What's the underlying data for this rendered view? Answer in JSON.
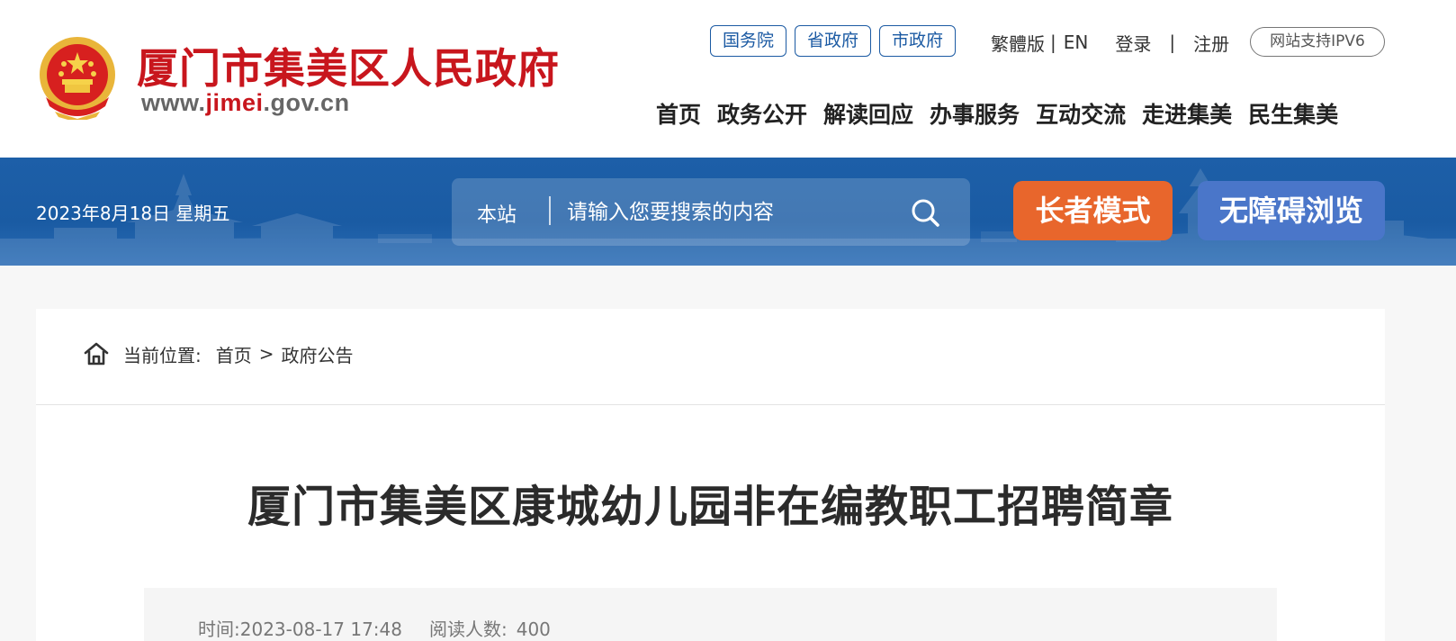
{
  "header": {
    "site_title": "厦门市集美区人民政府",
    "url_prefix": "www.",
    "url_highlight": "jimei",
    "url_suffix": ".gov.cn",
    "gov_links": [
      {
        "label": "国务院"
      },
      {
        "label": "省政府"
      },
      {
        "label": "市政府"
      }
    ],
    "traditional": "繁體版",
    "sep1": "|",
    "english": "EN",
    "login": "登录",
    "sep2": "|",
    "register": "注册",
    "ipv6": "网站支持IPV6",
    "nav": [
      {
        "label": "首页"
      },
      {
        "label": "政务公开"
      },
      {
        "label": "解读回应"
      },
      {
        "label": "办事服务"
      },
      {
        "label": "互动交流"
      },
      {
        "label": "走进集美"
      },
      {
        "label": "民生集美"
      }
    ]
  },
  "banner": {
    "date": "2023年8月18日 星期五",
    "search_scope": "本站",
    "search_placeholder": "请输入您要搜索的内容",
    "elder_mode": "长者模式",
    "accessible": "无障碍浏览"
  },
  "breadcrumb": {
    "label": "当前位置:",
    "home": "首页",
    "separator": ">",
    "current": "政府公告"
  },
  "article": {
    "title": "厦门市集美区康城幼儿园非在编教职工招聘简章",
    "time_label": "时间:",
    "time_value": "2023-08-17 17:48",
    "reads_label": "阅读人数:",
    "reads_value": "400"
  },
  "colors": {
    "brand_red": "#c8161d",
    "banner_blue": "#1a5ba3",
    "elder_orange": "#e8662c",
    "access_blue": "#4a76c9"
  },
  "icons": [
    "national-emblem-icon",
    "search-icon",
    "home-icon"
  ]
}
